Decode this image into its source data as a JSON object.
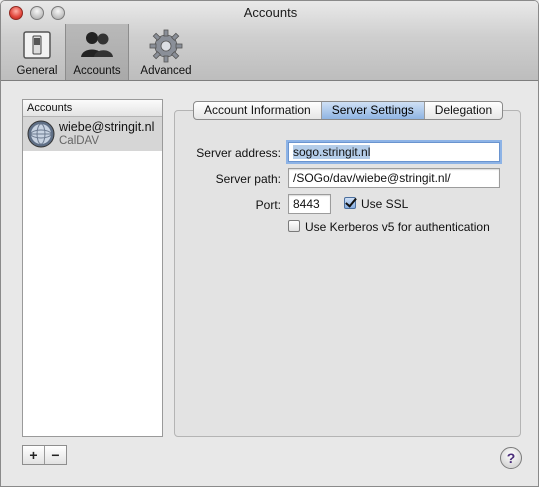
{
  "window": {
    "title": "Accounts"
  },
  "toolbar": {
    "items": [
      {
        "label": "General",
        "icon": "switch-icon"
      },
      {
        "label": "Accounts",
        "icon": "people-icon",
        "selected": true
      },
      {
        "label": "Advanced",
        "icon": "gear-icon"
      }
    ]
  },
  "accounts": {
    "header": "Accounts",
    "items": [
      {
        "name": "wiebe@stringit.nl",
        "type": "CalDAV",
        "icon": "globe-icon",
        "selected": true
      }
    ],
    "add_label": "+",
    "remove_label": "−"
  },
  "tabs": [
    {
      "label": "Account Information",
      "selected": false
    },
    {
      "label": "Server Settings",
      "selected": true
    },
    {
      "label": "Delegation",
      "selected": false
    }
  ],
  "server_settings": {
    "server_address_label": "Server address:",
    "server_address_value": "sogo.stringit.nl",
    "server_path_label": "Server path:",
    "server_path_value": "/SOGo/dav/wiebe@stringit.nl/",
    "port_label": "Port:",
    "port_value": "8443",
    "use_ssl_label": "Use SSL",
    "use_ssl_checked": true,
    "kerberos_label": "Use Kerberos v5 for authentication",
    "kerberos_checked": false
  },
  "help": {
    "label": "?"
  },
  "colors": {
    "selection": "#b4cde9",
    "tab_selected": "#8fb4e2",
    "close_button": "#e0443a"
  }
}
